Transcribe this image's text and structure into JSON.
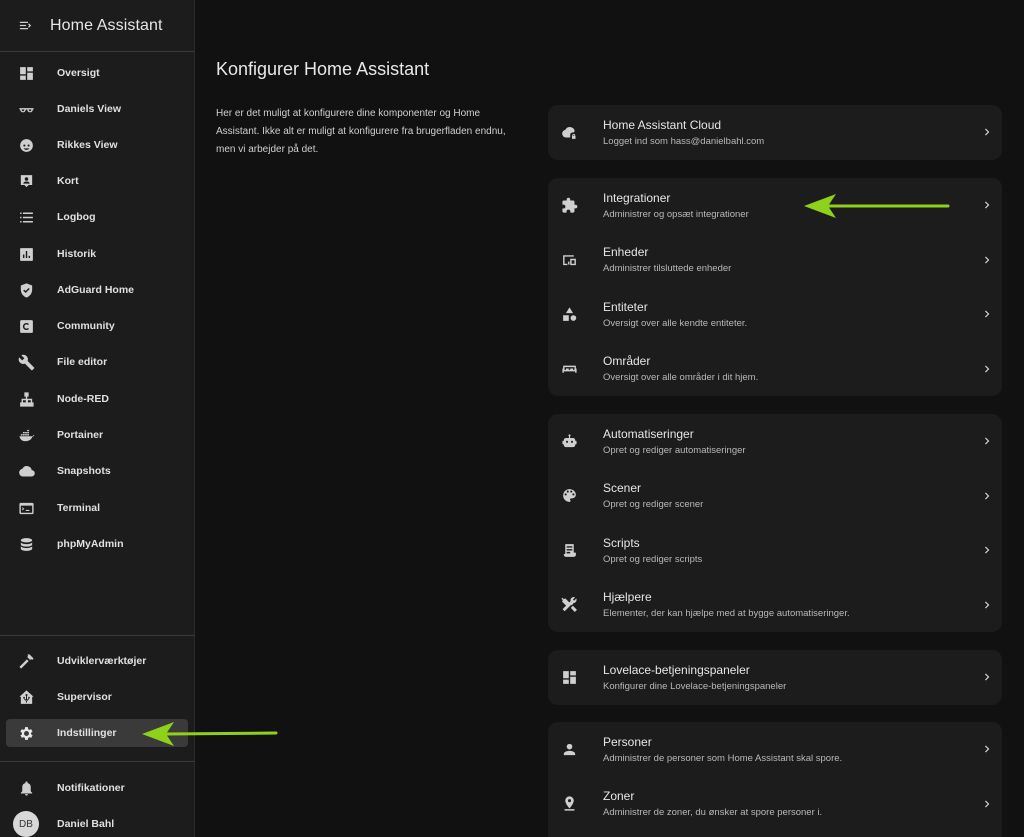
{
  "app": {
    "title": "Home Assistant"
  },
  "sidebar": {
    "items": [
      {
        "label": "Oversigt",
        "icon": "dashboard-icon"
      },
      {
        "label": "Daniels View",
        "icon": "glasses-icon"
      },
      {
        "label": "Rikkes View",
        "icon": "face-icon"
      },
      {
        "label": "Kort",
        "icon": "map-account-icon"
      },
      {
        "label": "Logbog",
        "icon": "list-icon"
      },
      {
        "label": "Historik",
        "icon": "chart-box-icon"
      },
      {
        "label": "AdGuard Home",
        "icon": "shield-check-icon"
      },
      {
        "label": "Community",
        "icon": "community-icon"
      },
      {
        "label": "File editor",
        "icon": "wrench-icon"
      },
      {
        "label": "Node-RED",
        "icon": "sitemap-icon"
      },
      {
        "label": "Portainer",
        "icon": "docker-icon"
      },
      {
        "label": "Snapshots",
        "icon": "cloud-icon"
      },
      {
        "label": "Terminal",
        "icon": "console-icon"
      },
      {
        "label": "phpMyAdmin",
        "icon": "database-icon"
      }
    ],
    "bottom_items": [
      {
        "label": "Udviklerværktøjer",
        "icon": "hammer-icon"
      },
      {
        "label": "Supervisor",
        "icon": "home-assistant-icon"
      },
      {
        "label": "Indstillinger",
        "icon": "gear-icon",
        "active": true
      }
    ],
    "notifications_label": "Notifikationer",
    "user": {
      "initials": "DB",
      "name": "Daniel Bahl"
    }
  },
  "main": {
    "title": "Konfigurer Home Assistant",
    "intro": "Her er det muligt at konfigurere dine komponenter og Home Assistant. Ikke alt er muligt at konfigurere fra brugerfladen endnu, men vi arbejder på det.",
    "cards": [
      {
        "rows": [
          {
            "title": "Home Assistant Cloud",
            "subtitle": "Logget ind som hass@danielbahl.com",
            "icon": "cloud-lock-icon"
          }
        ]
      },
      {
        "rows": [
          {
            "title": "Integrationer",
            "subtitle": "Administrer og opsæt integrationer",
            "icon": "puzzle-icon"
          },
          {
            "title": "Enheder",
            "subtitle": "Administrer tilsluttede enheder",
            "icon": "devices-icon"
          },
          {
            "title": "Entiteter",
            "subtitle": "Oversigt over alle kendte entiteter.",
            "icon": "shape-icon"
          },
          {
            "title": "Områder",
            "subtitle": "Oversigt over alle områder i dit hjem.",
            "icon": "sofa-icon"
          }
        ]
      },
      {
        "rows": [
          {
            "title": "Automatiseringer",
            "subtitle": "Opret og rediger automatiseringer",
            "icon": "robot-icon"
          },
          {
            "title": "Scener",
            "subtitle": "Opret og rediger scener",
            "icon": "palette-icon"
          },
          {
            "title": "Scripts",
            "subtitle": "Opret og rediger scripts",
            "icon": "script-icon"
          },
          {
            "title": "Hjælpere",
            "subtitle": "Elementer, der kan hjælpe med at bygge automatiseringer.",
            "icon": "tools-icon"
          }
        ]
      },
      {
        "rows": [
          {
            "title": "Lovelace-betjeningspaneler",
            "subtitle": "Konfigurer dine Lovelace-betjeningspaneler",
            "icon": "view-dashboard-icon"
          }
        ]
      },
      {
        "rows": [
          {
            "title": "Personer",
            "subtitle": "Administrer de personer som Home Assistant skal spore.",
            "icon": "account-icon"
          },
          {
            "title": "Zoner",
            "subtitle": "Administrer de zoner, du ønsker at spore personer i.",
            "icon": "map-marker-icon"
          }
        ]
      }
    ]
  },
  "annotations": {
    "arrow_color": "#8fd11a"
  }
}
